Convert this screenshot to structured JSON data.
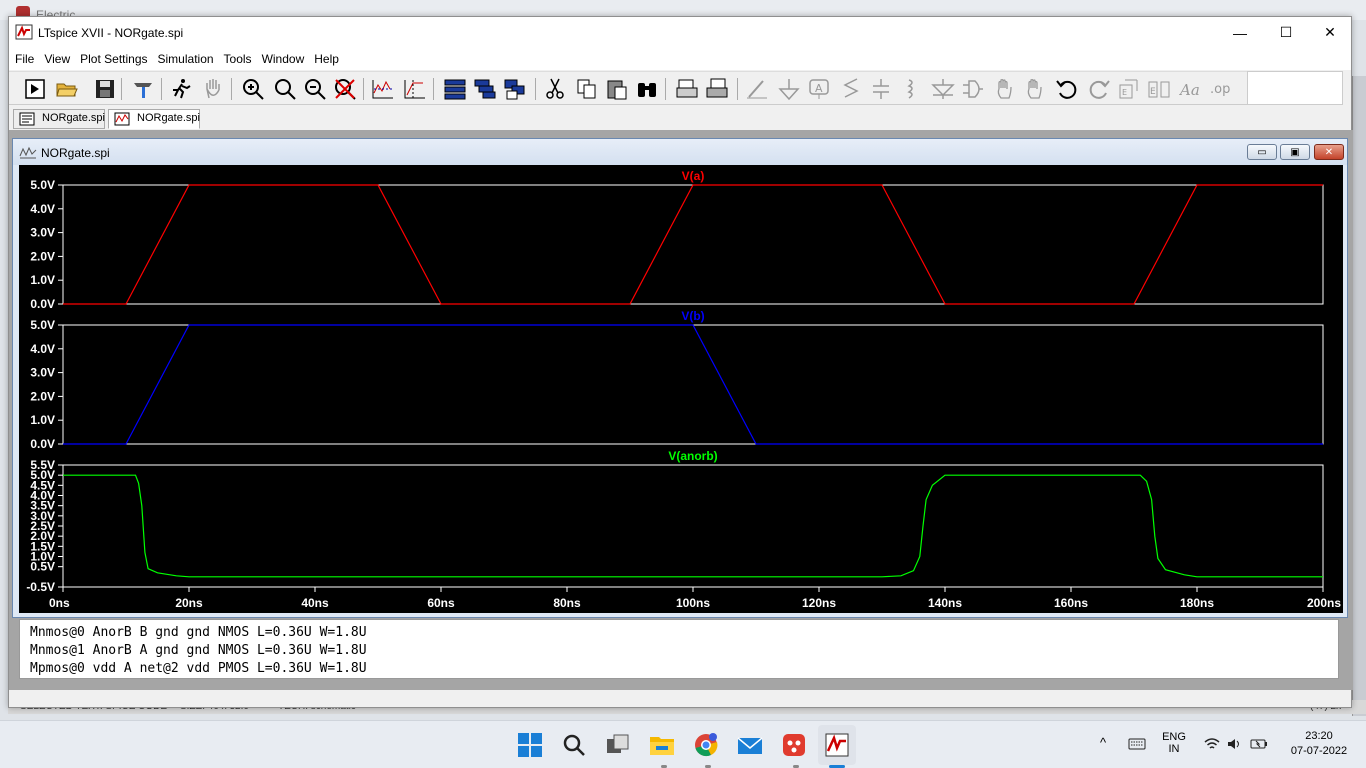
{
  "background_app": {
    "title": "Electric",
    "status_segments": [
      "SELECTED TEXT: SPICE CODE",
      "SIZE: 40 x 32.0",
      "TECH: schematic",
      "(47) 2x"
    ]
  },
  "window": {
    "title": "LTspice XVII - NORgate.spi",
    "minimize": "—",
    "maximize": "☐",
    "close": "✕"
  },
  "menu": [
    "File",
    "View",
    "Plot Settings",
    "Simulation",
    "Tools",
    "Window",
    "Help"
  ],
  "toolbar_icons": [
    "schematic-icon",
    "open-icon",
    "save-icon",
    "control-panel-icon",
    "run-icon",
    "halt-icon",
    "zoom-in-icon",
    "zoom-fit-icon",
    "zoom-out-icon",
    "zoom-cancel-icon",
    "autorange-icon",
    "mark-icon",
    "tile-horizontal-icon",
    "tile-vertical-icon",
    "cascade-icon",
    "cut-icon",
    "copy-icon",
    "paste-icon",
    "find-icon",
    "print-preview-icon",
    "print-icon",
    "wire-icon",
    "ground-icon",
    "label-icon",
    "resistor-icon",
    "capacitor-icon",
    "inductor-icon",
    "diode-icon",
    "component-icon",
    "move-icon",
    "drag-icon",
    "undo-icon",
    "redo-icon",
    "rotate-icon",
    "mirror-icon",
    "text-icon",
    "spice-directive-icon"
  ],
  "tabs": [
    {
      "label": "NORgate.spi",
      "active": false
    },
    {
      "label": "NORgate.spi",
      "active": true
    }
  ],
  "plot_window": {
    "title": "NORgate.spi",
    "min": "▭",
    "restore": "▣",
    "close": "✕"
  },
  "chart_data": {
    "type": "line",
    "x_axis": {
      "ticks": [
        "0ns",
        "20ns",
        "40ns",
        "60ns",
        "80ns",
        "100ns",
        "120ns",
        "140ns",
        "160ns",
        "180ns",
        "200ns"
      ],
      "range_ns": [
        0,
        200
      ]
    },
    "panes": [
      {
        "name": "V(a)",
        "color": "#ff0000",
        "y_ticks": [
          "0.0V",
          "1.0V",
          "2.0V",
          "3.0V",
          "4.0V",
          "5.0V"
        ],
        "ylim": [
          0,
          5
        ],
        "points": [
          [
            0,
            0
          ],
          [
            10,
            0
          ],
          [
            20,
            5
          ],
          [
            50,
            5
          ],
          [
            60,
            0
          ],
          [
            90,
            0
          ],
          [
            100,
            5
          ],
          [
            130,
            5
          ],
          [
            140,
            0
          ],
          [
            170,
            0
          ],
          [
            180,
            5
          ],
          [
            200,
            5
          ]
        ]
      },
      {
        "name": "V(b)",
        "color": "#0000ff",
        "y_ticks": [
          "0.0V",
          "1.0V",
          "2.0V",
          "3.0V",
          "4.0V",
          "5.0V"
        ],
        "ylim": [
          0,
          5
        ],
        "points": [
          [
            0,
            0
          ],
          [
            10,
            0
          ],
          [
            20,
            5
          ],
          [
            100,
            5
          ],
          [
            110,
            0
          ],
          [
            200,
            0
          ]
        ]
      },
      {
        "name": "V(anorb)",
        "color": "#00ff00",
        "y_ticks": [
          "-0.5V",
          "0.5V",
          "1.0V",
          "1.5V",
          "2.0V",
          "2.5V",
          "3.0V",
          "3.5V",
          "4.0V",
          "4.5V",
          "5.0V",
          "5.5V"
        ],
        "ylim": [
          -0.5,
          5.5
        ],
        "y_tick_values": [
          -0.5,
          0.5,
          1.0,
          1.5,
          2.0,
          2.5,
          3.0,
          3.5,
          4.0,
          4.5,
          5.0,
          5.5
        ],
        "points": [
          [
            0,
            5
          ],
          [
            11.5,
            5
          ],
          [
            12,
            4.6
          ],
          [
            12.5,
            3.5
          ],
          [
            13,
            1.2
          ],
          [
            13.5,
            0.4
          ],
          [
            15,
            0.2
          ],
          [
            18,
            0.05
          ],
          [
            20,
            0
          ],
          [
            130,
            0
          ],
          [
            133,
            0.05
          ],
          [
            135,
            0.3
          ],
          [
            136,
            1.0
          ],
          [
            136.5,
            2.5
          ],
          [
            137,
            3.8
          ],
          [
            138,
            4.5
          ],
          [
            140,
            5
          ],
          [
            171,
            5
          ],
          [
            172,
            4.7
          ],
          [
            172.8,
            3.8
          ],
          [
            173.3,
            2.0
          ],
          [
            173.8,
            0.9
          ],
          [
            175,
            0.35
          ],
          [
            178,
            0.1
          ],
          [
            180,
            0
          ],
          [
            200,
            0
          ]
        ]
      }
    ]
  },
  "netlist": [
    "Mnmos@0 AnorB B gnd gnd NMOS L=0.36U W=1.8U",
    "Mnmos@1 AnorB A gnd gnd NMOS L=0.36U W=1.8U",
    "Mpmos@0 vdd A net@2 vdd PMOS L=0.36U W=1.8U"
  ],
  "taskbar": {
    "apps": [
      "windows-start-icon",
      "search-icon",
      "task-view-icon",
      "file-explorer-icon",
      "chrome-icon",
      "mail-icon",
      "electric-app-icon",
      "ltspice-app-icon"
    ],
    "tray_chevron": "^",
    "lang_top": "ENG",
    "lang_bottom": "IN",
    "time": "23:20",
    "date": "07-07-2022"
  },
  "colors": {
    "plot_bg": "#000000",
    "plot_axis": "#ffffff",
    "title_accent": "#dfe9f5"
  }
}
